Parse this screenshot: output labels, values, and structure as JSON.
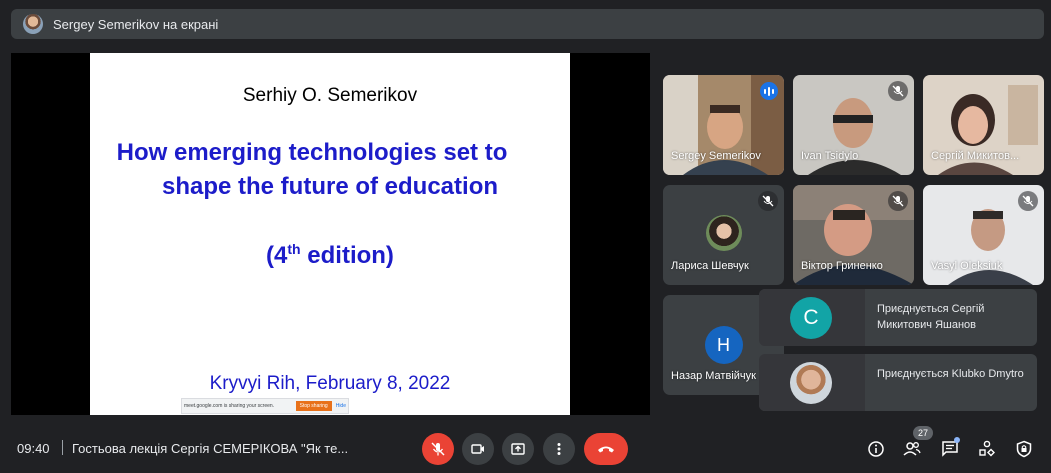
{
  "presenter_bar": {
    "text": "Sergey Semerikov на екрані"
  },
  "slide": {
    "author": "Serhiy O. Semerikov",
    "title_line1": "How emerging technologies set to",
    "title_line2": "shape the future of education",
    "edition_prefix": "(4",
    "edition_sup": "th",
    "edition_suffix": " edition)",
    "place_date": "Kryvyi Rih, February 8, 2022"
  },
  "share_bar": {
    "message": "meet.google.com is sharing your screen.",
    "stop_label": "Stop sharing",
    "hide_label": "Hide"
  },
  "participants": [
    {
      "name": "Sergey Semerikov",
      "speaking": true
    },
    {
      "name": "Ivan Tsidylo",
      "muted": true
    },
    {
      "name": "Сергій Микитов...",
      "muted": false
    },
    {
      "name": "Лариса Шевчук",
      "muted": true
    },
    {
      "name": "Віктор Гриненко",
      "muted": true
    },
    {
      "name": "Vasyl Oleksiuk",
      "muted": true
    },
    {
      "name": "Назар Матвійчук",
      "initial": "H",
      "avatar_color": "#1565c0"
    }
  ],
  "notifications": [
    {
      "initial": "C",
      "color": "#12a4a6",
      "text": "Приєднується Сергій Микитович Яшанов"
    },
    {
      "text": "Приєднується Klubko Dmytro"
    }
  ],
  "bottom": {
    "time": "09:40",
    "meeting_title": "Гостьова лекція Сергія СЕМЕРІКОВА \"Як те...",
    "participants_count": "27"
  },
  "colors": {
    "background": "#202124",
    "surface": "#3c4043",
    "danger": "#ea4335",
    "accent": "#8ab4f8",
    "slide_text": "#1c1cc9"
  }
}
